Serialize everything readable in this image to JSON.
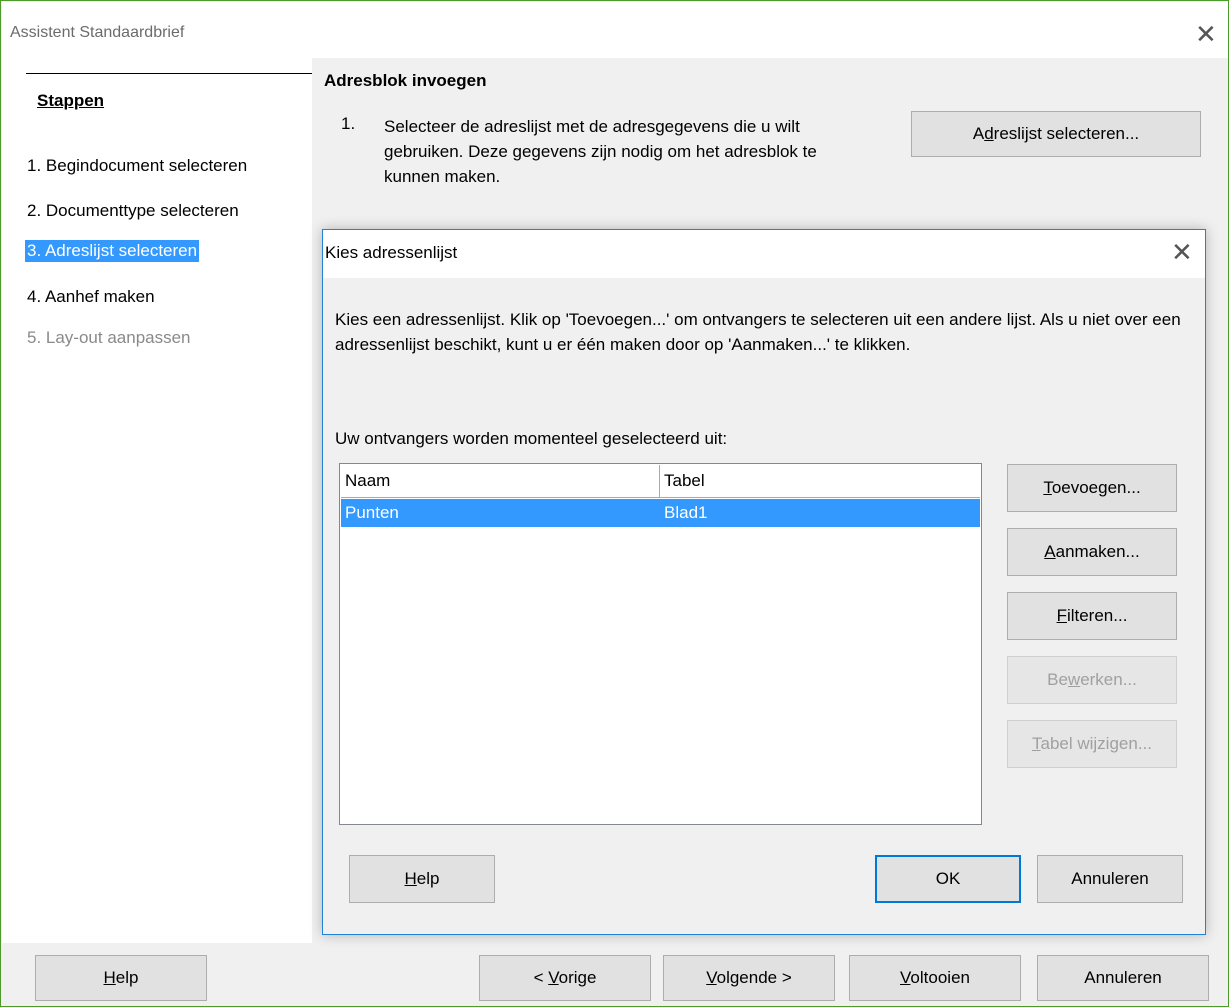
{
  "window": {
    "title": "Assistent Standaardbrief"
  },
  "sidebar": {
    "heading": "Stappen",
    "steps": [
      {
        "label": "1. Begindocument selecteren",
        "state": "normal"
      },
      {
        "label": "2. Documenttype selecteren",
        "state": "normal"
      },
      {
        "label": "3. Adreslijst selecteren",
        "state": "selected"
      },
      {
        "label": "4. Aanhef maken",
        "state": "normal"
      },
      {
        "label": "5. Lay-out aanpassen",
        "state": "disabled"
      }
    ]
  },
  "main": {
    "heading": "Adresblok invoegen",
    "instruction_number": "1.",
    "instruction_text": "Selecteer de adreslijst met de adresgegevens die u wilt gebruiken. Deze gegevens zijn nodig om het adresblok te kunnen maken.",
    "select_button": {
      "pre": "A",
      "accel": "d",
      "post": "reslijst selecteren..."
    }
  },
  "dialog": {
    "title": "Kies adressenlijst",
    "description": "Kies een adressenlijst. Klik op 'Toevoegen...' om ontvangers te selecteren uit een andere lijst. Als u niet over een adressenlijst beschikt, kunt u er één maken door op 'Aanmaken...' te klikken.",
    "sublabel": "Uw ontvangers worden momenteel geselecteerd uit:",
    "columns": [
      "Naam",
      "Tabel"
    ],
    "rows": [
      {
        "naam": "Punten",
        "tabel": "Blad1",
        "selected": true
      }
    ],
    "buttons": {
      "add": {
        "pre": "",
        "accel": "T",
        "post": "oevoegen..."
      },
      "create": {
        "pre": "",
        "accel": "A",
        "post": "anmaken..."
      },
      "filter": {
        "pre": "",
        "accel": "F",
        "post": "ilteren..."
      },
      "edit": {
        "pre": "Be",
        "accel": "w",
        "post": "erken..."
      },
      "change_table": {
        "pre": "",
        "accel": "T",
        "post": "abel wijzigen..."
      },
      "help": {
        "pre": "",
        "accel": "H",
        "post": "elp"
      },
      "ok": "OK",
      "cancel": "Annuleren"
    }
  },
  "footer": {
    "help": {
      "pre": "",
      "accel": "H",
      "post": "elp"
    },
    "previous": {
      "pre": "< ",
      "accel": "V",
      "post": "orige"
    },
    "next": {
      "pre": "",
      "accel": "V",
      "post": "olgende >"
    },
    "finish": {
      "pre": "",
      "accel": "V",
      "post": "oltooien"
    },
    "cancel": "Annuleren"
  },
  "colors": {
    "selection": "#3399ff",
    "dialog_border": "#1f83d6",
    "window_border": "#4c9a2a"
  }
}
